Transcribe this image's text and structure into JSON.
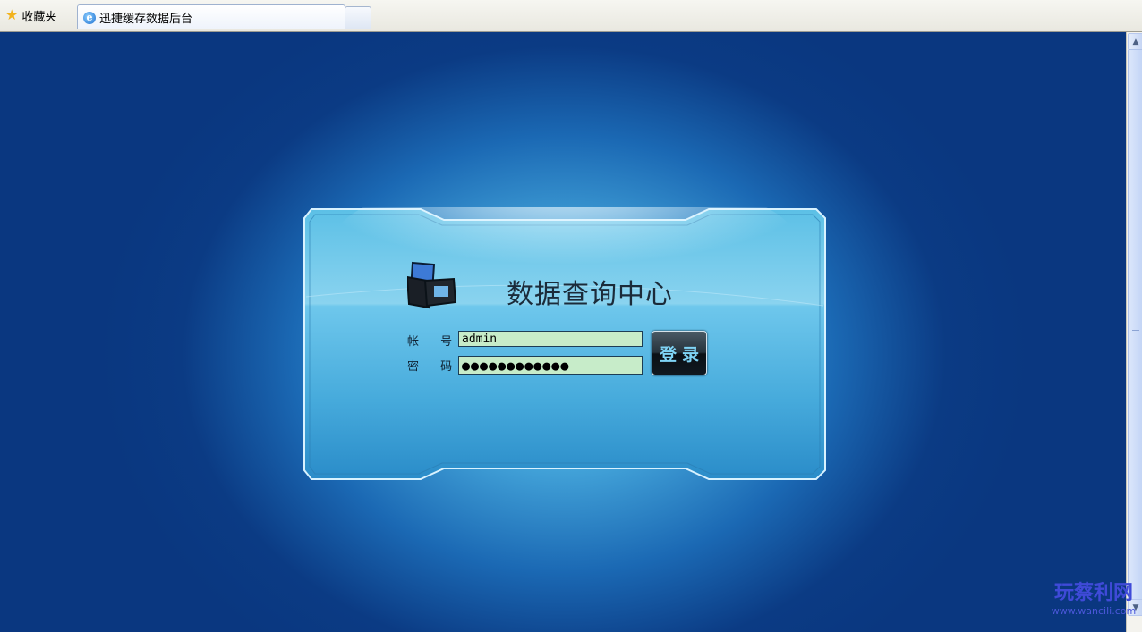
{
  "browser": {
    "favorites_label": "收藏夹",
    "tab_title": "迅捷缓存数据后台"
  },
  "login": {
    "title": "数据查询中心",
    "username_label": "帐 号：",
    "password_label": "密 码：",
    "username_value": "admin",
    "password_value": "●●●●●●●●●●●●",
    "login_button": "登录"
  },
  "watermark": {
    "name": "玩蔡利网",
    "url": "www.wancili.com"
  },
  "colors": {
    "background": "#0b3b84",
    "panel_glow": "#9bdff4",
    "input_bg": "#c7ecc9",
    "button_text": "#7fd4f6"
  },
  "icons": [
    "star-icon",
    "ie-icon",
    "logo-icon",
    "scroll-up-icon",
    "scroll-down-icon"
  ]
}
